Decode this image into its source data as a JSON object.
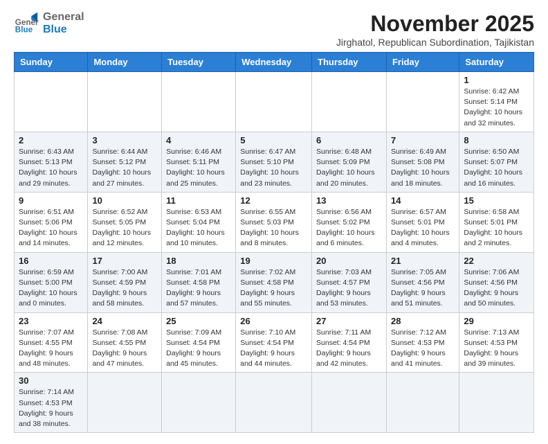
{
  "logo": {
    "line1": "General",
    "line2": "Blue"
  },
  "title": "November 2025",
  "subtitle": "Jirghatol, Republican Subordination, Tajikistan",
  "days_of_week": [
    "Sunday",
    "Monday",
    "Tuesday",
    "Wednesday",
    "Thursday",
    "Friday",
    "Saturday"
  ],
  "weeks": [
    [
      {
        "day": "",
        "info": ""
      },
      {
        "day": "",
        "info": ""
      },
      {
        "day": "",
        "info": ""
      },
      {
        "day": "",
        "info": ""
      },
      {
        "day": "",
        "info": ""
      },
      {
        "day": "",
        "info": ""
      },
      {
        "day": "1",
        "info": "Sunrise: 6:42 AM\nSunset: 5:14 PM\nDaylight: 10 hours and 32 minutes."
      }
    ],
    [
      {
        "day": "2",
        "info": "Sunrise: 6:43 AM\nSunset: 5:13 PM\nDaylight: 10 hours and 29 minutes."
      },
      {
        "day": "3",
        "info": "Sunrise: 6:44 AM\nSunset: 5:12 PM\nDaylight: 10 hours and 27 minutes."
      },
      {
        "day": "4",
        "info": "Sunrise: 6:46 AM\nSunset: 5:11 PM\nDaylight: 10 hours and 25 minutes."
      },
      {
        "day": "5",
        "info": "Sunrise: 6:47 AM\nSunset: 5:10 PM\nDaylight: 10 hours and 23 minutes."
      },
      {
        "day": "6",
        "info": "Sunrise: 6:48 AM\nSunset: 5:09 PM\nDaylight: 10 hours and 20 minutes."
      },
      {
        "day": "7",
        "info": "Sunrise: 6:49 AM\nSunset: 5:08 PM\nDaylight: 10 hours and 18 minutes."
      },
      {
        "day": "8",
        "info": "Sunrise: 6:50 AM\nSunset: 5:07 PM\nDaylight: 10 hours and 16 minutes."
      }
    ],
    [
      {
        "day": "9",
        "info": "Sunrise: 6:51 AM\nSunset: 5:06 PM\nDaylight: 10 hours and 14 minutes."
      },
      {
        "day": "10",
        "info": "Sunrise: 6:52 AM\nSunset: 5:05 PM\nDaylight: 10 hours and 12 minutes."
      },
      {
        "day": "11",
        "info": "Sunrise: 6:53 AM\nSunset: 5:04 PM\nDaylight: 10 hours and 10 minutes."
      },
      {
        "day": "12",
        "info": "Sunrise: 6:55 AM\nSunset: 5:03 PM\nDaylight: 10 hours and 8 minutes."
      },
      {
        "day": "13",
        "info": "Sunrise: 6:56 AM\nSunset: 5:02 PM\nDaylight: 10 hours and 6 minutes."
      },
      {
        "day": "14",
        "info": "Sunrise: 6:57 AM\nSunset: 5:01 PM\nDaylight: 10 hours and 4 minutes."
      },
      {
        "day": "15",
        "info": "Sunrise: 6:58 AM\nSunset: 5:01 PM\nDaylight: 10 hours and 2 minutes."
      }
    ],
    [
      {
        "day": "16",
        "info": "Sunrise: 6:59 AM\nSunset: 5:00 PM\nDaylight: 10 hours and 0 minutes."
      },
      {
        "day": "17",
        "info": "Sunrise: 7:00 AM\nSunset: 4:59 PM\nDaylight: 9 hours and 58 minutes."
      },
      {
        "day": "18",
        "info": "Sunrise: 7:01 AM\nSunset: 4:58 PM\nDaylight: 9 hours and 57 minutes."
      },
      {
        "day": "19",
        "info": "Sunrise: 7:02 AM\nSunset: 4:58 PM\nDaylight: 9 hours and 55 minutes."
      },
      {
        "day": "20",
        "info": "Sunrise: 7:03 AM\nSunset: 4:57 PM\nDaylight: 9 hours and 53 minutes."
      },
      {
        "day": "21",
        "info": "Sunrise: 7:05 AM\nSunset: 4:56 PM\nDaylight: 9 hours and 51 minutes."
      },
      {
        "day": "22",
        "info": "Sunrise: 7:06 AM\nSunset: 4:56 PM\nDaylight: 9 hours and 50 minutes."
      }
    ],
    [
      {
        "day": "23",
        "info": "Sunrise: 7:07 AM\nSunset: 4:55 PM\nDaylight: 9 hours and 48 minutes."
      },
      {
        "day": "24",
        "info": "Sunrise: 7:08 AM\nSunset: 4:55 PM\nDaylight: 9 hours and 47 minutes."
      },
      {
        "day": "25",
        "info": "Sunrise: 7:09 AM\nSunset: 4:54 PM\nDaylight: 9 hours and 45 minutes."
      },
      {
        "day": "26",
        "info": "Sunrise: 7:10 AM\nSunset: 4:54 PM\nDaylight: 9 hours and 44 minutes."
      },
      {
        "day": "27",
        "info": "Sunrise: 7:11 AM\nSunset: 4:54 PM\nDaylight: 9 hours and 42 minutes."
      },
      {
        "day": "28",
        "info": "Sunrise: 7:12 AM\nSunset: 4:53 PM\nDaylight: 9 hours and 41 minutes."
      },
      {
        "day": "29",
        "info": "Sunrise: 7:13 AM\nSunset: 4:53 PM\nDaylight: 9 hours and 39 minutes."
      }
    ],
    [
      {
        "day": "30",
        "info": "Sunrise: 7:14 AM\nSunset: 4:53 PM\nDaylight: 9 hours and 38 minutes."
      },
      {
        "day": "",
        "info": ""
      },
      {
        "day": "",
        "info": ""
      },
      {
        "day": "",
        "info": ""
      },
      {
        "day": "",
        "info": ""
      },
      {
        "day": "",
        "info": ""
      },
      {
        "day": "",
        "info": ""
      }
    ]
  ]
}
